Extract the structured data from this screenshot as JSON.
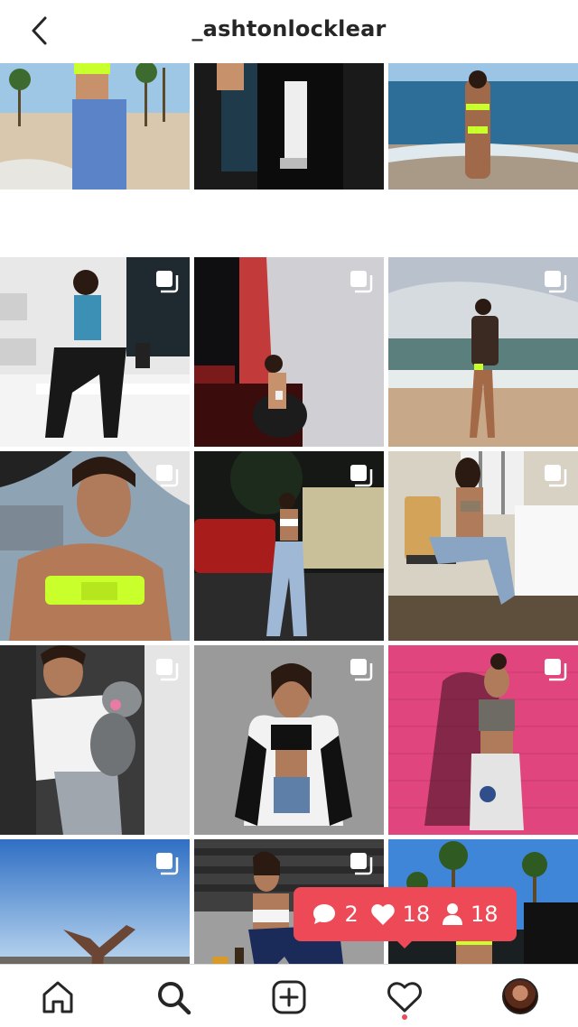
{
  "header": {
    "username": "_ashtonlocklear"
  },
  "grid": {
    "posts": [
      {
        "id": "post-1",
        "multi": false,
        "label": "beach-promenade-jeans"
      },
      {
        "id": "post-2",
        "multi": false,
        "label": "night-friends"
      },
      {
        "id": "post-3",
        "multi": false,
        "label": "ocean-bikini"
      },
      {
        "id": "post-4",
        "multi": true,
        "label": "stairs-sitting"
      },
      {
        "id": "post-5",
        "multi": true,
        "label": "red-light-wall"
      },
      {
        "id": "post-6",
        "multi": true,
        "label": "beach-hoodie"
      },
      {
        "id": "post-7",
        "multi": true,
        "label": "neon-bandeau-selfie"
      },
      {
        "id": "post-8",
        "multi": true,
        "label": "night-street-jeans"
      },
      {
        "id": "post-9",
        "multi": true,
        "label": "hotel-room-chair"
      },
      {
        "id": "post-10",
        "multi": true,
        "label": "holding-dog"
      },
      {
        "id": "post-11",
        "multi": true,
        "label": "varsity-jacket"
      },
      {
        "id": "post-12",
        "multi": true,
        "label": "pink-wall"
      },
      {
        "id": "post-13",
        "multi": true,
        "label": "handstand-view"
      },
      {
        "id": "post-14",
        "multi": true,
        "label": "sitting-outdoor"
      },
      {
        "id": "post-15",
        "multi": false,
        "label": "car-door-palms"
      }
    ]
  },
  "activity": {
    "comments": "2",
    "likes": "18",
    "follows": "18",
    "color": "#ed4956"
  },
  "nav": {
    "items": [
      "home-icon",
      "search-icon",
      "new-post-icon",
      "activity-icon",
      "profile-avatar"
    ]
  }
}
